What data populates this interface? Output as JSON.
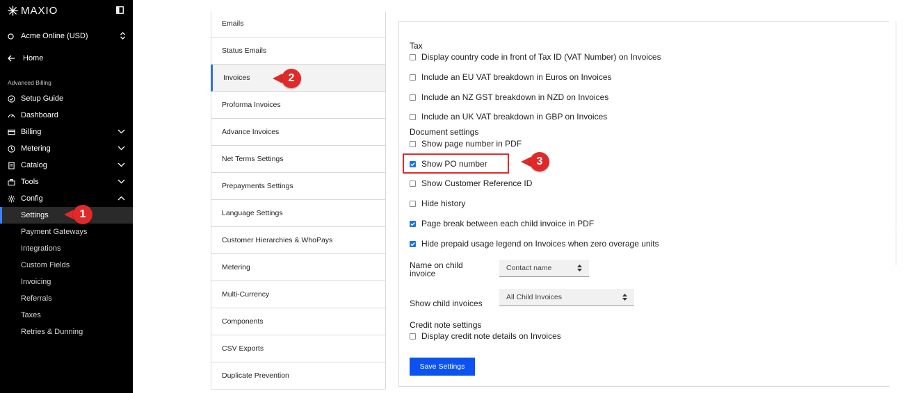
{
  "brand": {
    "logo_text": "MAXIO"
  },
  "org": {
    "label": "Acme Online (USD)"
  },
  "home": {
    "label": "Home"
  },
  "sidebar": {
    "section_label": "Advanced Billing",
    "items": [
      {
        "label": "Setup Guide",
        "icon": "check-circle-icon",
        "chevron": ""
      },
      {
        "label": "Dashboard",
        "icon": "gauge-icon",
        "chevron": ""
      },
      {
        "label": "Billing",
        "icon": "billing-icon",
        "chevron": "down"
      },
      {
        "label": "Metering",
        "icon": "metering-icon",
        "chevron": "down"
      },
      {
        "label": "Catalog",
        "icon": "catalog-icon",
        "chevron": "down"
      },
      {
        "label": "Tools",
        "icon": "toolbox-icon",
        "chevron": "down"
      },
      {
        "label": "Config",
        "icon": "gear-icon",
        "chevron": "up"
      }
    ],
    "config_sub": [
      "Settings",
      "Payment Gateways",
      "Integrations",
      "Custom Fields",
      "Invoicing",
      "Referrals",
      "Taxes",
      "Retries & Dunning"
    ]
  },
  "callouts": [
    "1",
    "2",
    "3"
  ],
  "settings_menu": [
    "Emails",
    "Status Emails",
    "Invoices",
    "Proforma Invoices",
    "Advance Invoices",
    "Net Terms Settings",
    "Prepayments Settings",
    "Language Settings",
    "Customer Hierarchies & WhoPays",
    "Metering",
    "Multi-Currency",
    "Components",
    "CSV Exports",
    "Duplicate Prevention"
  ],
  "tax": {
    "title": "Tax",
    "options": [
      {
        "label": "Display country code in front of Tax ID (VAT Number) on Invoices",
        "checked": false
      },
      {
        "label": "Include an EU VAT breakdown in Euros on Invoices",
        "checked": false
      },
      {
        "label": "Include an NZ GST breakdown in NZD on Invoices",
        "checked": false
      },
      {
        "label": "Include an UK VAT breakdown in GBP on Invoices",
        "checked": false
      }
    ]
  },
  "document": {
    "title": "Document settings",
    "options": [
      {
        "label": "Show page number in PDF",
        "checked": false
      },
      {
        "label": "Show PO number",
        "checked": true
      },
      {
        "label": "Show Customer Reference ID",
        "checked": false
      },
      {
        "label": "Hide history",
        "checked": false
      },
      {
        "label": "Page break between each child invoice in PDF",
        "checked": true
      },
      {
        "label": "Hide prepaid usage legend on Invoices when zero overage units",
        "checked": true
      }
    ]
  },
  "name_on_child": {
    "label_line1": "Name on child",
    "label_line2": "invoice",
    "value": "Contact name"
  },
  "show_child": {
    "label": "Show child invoices",
    "value": "All Child Invoices"
  },
  "credit": {
    "title": "Credit note settings",
    "options": [
      {
        "label": "Display credit note details on Invoices",
        "checked": false
      }
    ]
  },
  "save_label": "Save Settings",
  "colors": {
    "sidebar_bg": "#000000",
    "accent": "#0b52f0",
    "callout": "#e02a2a",
    "checkbox": "#1a73e8"
  }
}
